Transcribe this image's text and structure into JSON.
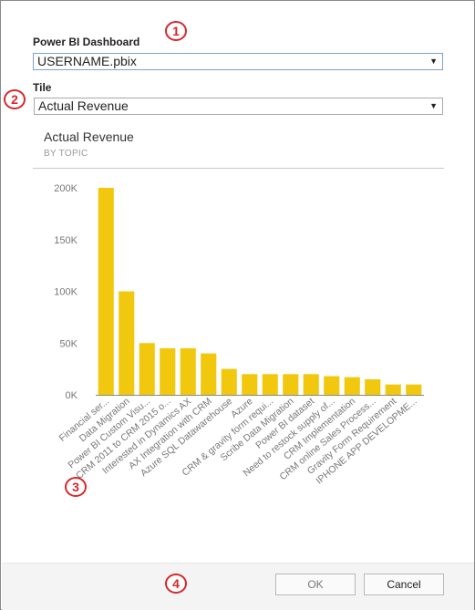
{
  "dashboard": {
    "label": "Power BI Dashboard",
    "value": "USERNAME.pbix"
  },
  "tile": {
    "label": "Tile",
    "value": "Actual Revenue"
  },
  "markers": [
    "1",
    "2",
    "3",
    "4"
  ],
  "buttons": {
    "ok": "OK",
    "cancel": "Cancel"
  },
  "colors": {
    "bar": "#f2c80f",
    "marker": "#d9262b"
  },
  "chart_data": {
    "type": "bar",
    "title": "Actual Revenue",
    "subtitle": "BY TOPIC",
    "ylim": [
      0,
      200000
    ],
    "yticks": [
      "0K",
      "50K",
      "100K",
      "150K",
      "200K"
    ],
    "categories": [
      "Financial ser...",
      "Data Migration",
      "Power BI Custom Visu...",
      "CRM 2011 to CRM 2015 o...",
      "Interested in Dynamics AX",
      "AX Integration with CRM",
      "Azure SQL Datawarehouse",
      "Azure",
      "CRM & gravity form requi...",
      "Scribe Data Migration",
      "Power BI dataset",
      "Need to restock supply of...",
      "CRM Implementation",
      "CRM online Sales Process...",
      "Gravity Form Requirement",
      "IPHONE APP DEVELOPME..."
    ],
    "values": [
      200000,
      100000,
      50000,
      45000,
      45000,
      40000,
      25000,
      20000,
      20000,
      20000,
      20000,
      18000,
      17000,
      15000,
      10000,
      10000
    ],
    "grid": false,
    "legend": "none"
  }
}
